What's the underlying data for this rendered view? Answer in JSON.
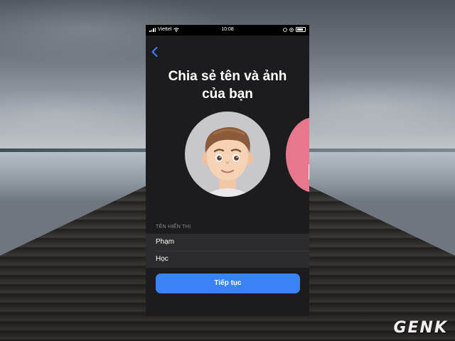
{
  "status_bar": {
    "carrier": "Viettel",
    "time": "10:08"
  },
  "screen": {
    "title_line1": "Chia sẻ tên và ảnh",
    "title_line2": "của bạn",
    "display_name_label": "TÊN HIỂN THỊ",
    "first_name": "Phạm",
    "last_name": "Học",
    "continue_label": "Tiếp tục"
  },
  "watermark": "GENK",
  "colors": {
    "accent": "#3b82f6",
    "sheet_bg": "#1c1c1e",
    "next_avatar": "#e7778d"
  }
}
